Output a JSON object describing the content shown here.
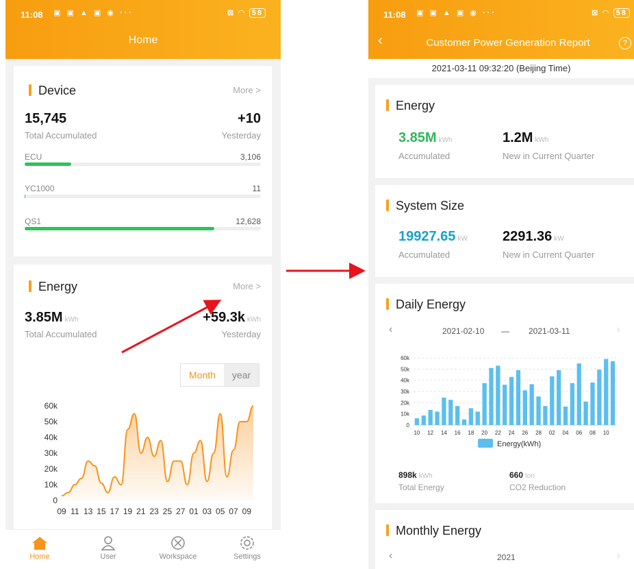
{
  "left": {
    "status": {
      "time": "11:08",
      "battery": "58"
    },
    "title": "Home",
    "device": {
      "heading": "Device",
      "more": "More >",
      "total": "15,745",
      "total_label": "Total Accumulated",
      "yesterday": "+10",
      "yesterday_label": "Yesterday",
      "rows": [
        {
          "label": "ECU",
          "value": "3,106",
          "fraction": 0.197
        },
        {
          "label": "YC1000",
          "value": "11",
          "fraction": 0.001
        },
        {
          "label": "QS1",
          "value": "12,628",
          "fraction": 0.802
        }
      ]
    },
    "energy": {
      "heading": "Energy",
      "more": "More >",
      "total": "3.85M",
      "total_unit": "kWh",
      "total_label": "Total Accumulated",
      "yesterday": "+59.3k",
      "yesterday_unit": "kWh",
      "yesterday_label": "Yesterday",
      "toggle_month": "Month",
      "toggle_year": "year"
    },
    "tabs": [
      {
        "label": "Home",
        "icon": "home-icon",
        "active": true
      },
      {
        "label": "User",
        "icon": "user-icon",
        "active": false
      },
      {
        "label": "Workspace",
        "icon": "workspace-icon",
        "active": false
      },
      {
        "label": "Settings",
        "icon": "settings-icon",
        "active": false
      }
    ]
  },
  "right": {
    "status": {
      "time": "11:08",
      "battery": "58"
    },
    "title": "Customer Power Generation Report",
    "timestamp": "2021-03-11 09:32:20 (Beijing Time)",
    "energy": {
      "heading": "Energy",
      "accumulated": "3.85M",
      "accumulated_unit": "kWh",
      "accumulated_label": "Accumulated",
      "quarter": "1.2M",
      "quarter_unit": "kWh",
      "quarter_label": "New in Current Quarter"
    },
    "system": {
      "heading": "System Size",
      "accumulated": "19927.65",
      "accumulated_unit": "kW",
      "accumulated_label": "Accumulated",
      "quarter": "2291.36",
      "quarter_unit": "kW",
      "quarter_label": "New in Current Quarter"
    },
    "daily": {
      "heading": "Daily Energy",
      "date_from": "2021-02-10",
      "date_sep": "—",
      "date_to": "2021-03-11",
      "total": "898k",
      "total_unit": "kWh",
      "total_label": "Total Energy",
      "co2": "660",
      "co2_unit": "ton",
      "co2_label": "CO2 Reduction"
    },
    "monthly": {
      "heading": "Monthly Energy",
      "year": "2021"
    }
  },
  "chart_data": [
    {
      "type": "area",
      "x": [
        "09",
        "10",
        "11",
        "12",
        "13",
        "14",
        "15",
        "16",
        "17",
        "18",
        "19",
        "20",
        "21",
        "22",
        "23",
        "24",
        "25",
        "26",
        "27",
        "28",
        "01",
        "02",
        "03",
        "04",
        "05",
        "06",
        "07",
        "08",
        "09",
        "10"
      ],
      "values": [
        3000,
        5000,
        10000,
        14000,
        25000,
        22000,
        11000,
        5000,
        15000,
        10000,
        45000,
        55000,
        30000,
        40000,
        28000,
        38000,
        12000,
        25000,
        25000,
        10000,
        30000,
        38000,
        12000,
        30000,
        55000,
        15000,
        32000,
        50000,
        50000,
        60000
      ],
      "xticks": [
        "09",
        "11",
        "13",
        "15",
        "17",
        "19",
        "21",
        "23",
        "25",
        "27",
        "01",
        "03",
        "05",
        "07",
        "09"
      ],
      "yticks": [
        "0",
        "10k",
        "20k",
        "30k",
        "40k",
        "50k",
        "60k"
      ],
      "ylim": [
        0,
        60000
      ],
      "color": "#f7941d"
    },
    {
      "type": "bar",
      "x": [
        "10",
        "11",
        "12",
        "13",
        "14",
        "15",
        "16",
        "17",
        "18",
        "19",
        "20",
        "21",
        "22",
        "23",
        "24",
        "25",
        "26",
        "27",
        "28",
        "01",
        "02",
        "03",
        "04",
        "05",
        "06",
        "07",
        "08",
        "09",
        "10",
        "11"
      ],
      "values": [
        6000,
        8500,
        13500,
        12000,
        24500,
        22500,
        17000,
        5000,
        15000,
        12000,
        37500,
        51000,
        53000,
        36000,
        43000,
        49000,
        31000,
        36500,
        25500,
        17000,
        43500,
        49000,
        16500,
        37500,
        55000,
        21000,
        38000,
        49500,
        59000,
        57000
      ],
      "xticks": [
        "10",
        "12",
        "14",
        "16",
        "18",
        "20",
        "22",
        "24",
        "26",
        "28",
        "02",
        "04",
        "06",
        "08",
        "10"
      ],
      "yticks": [
        "0",
        "10k",
        "20k",
        "30k",
        "40k",
        "50k",
        "60k"
      ],
      "ylim": [
        0,
        60000
      ],
      "legend": "Energy(kWh)",
      "color": "#5bbfee"
    }
  ]
}
